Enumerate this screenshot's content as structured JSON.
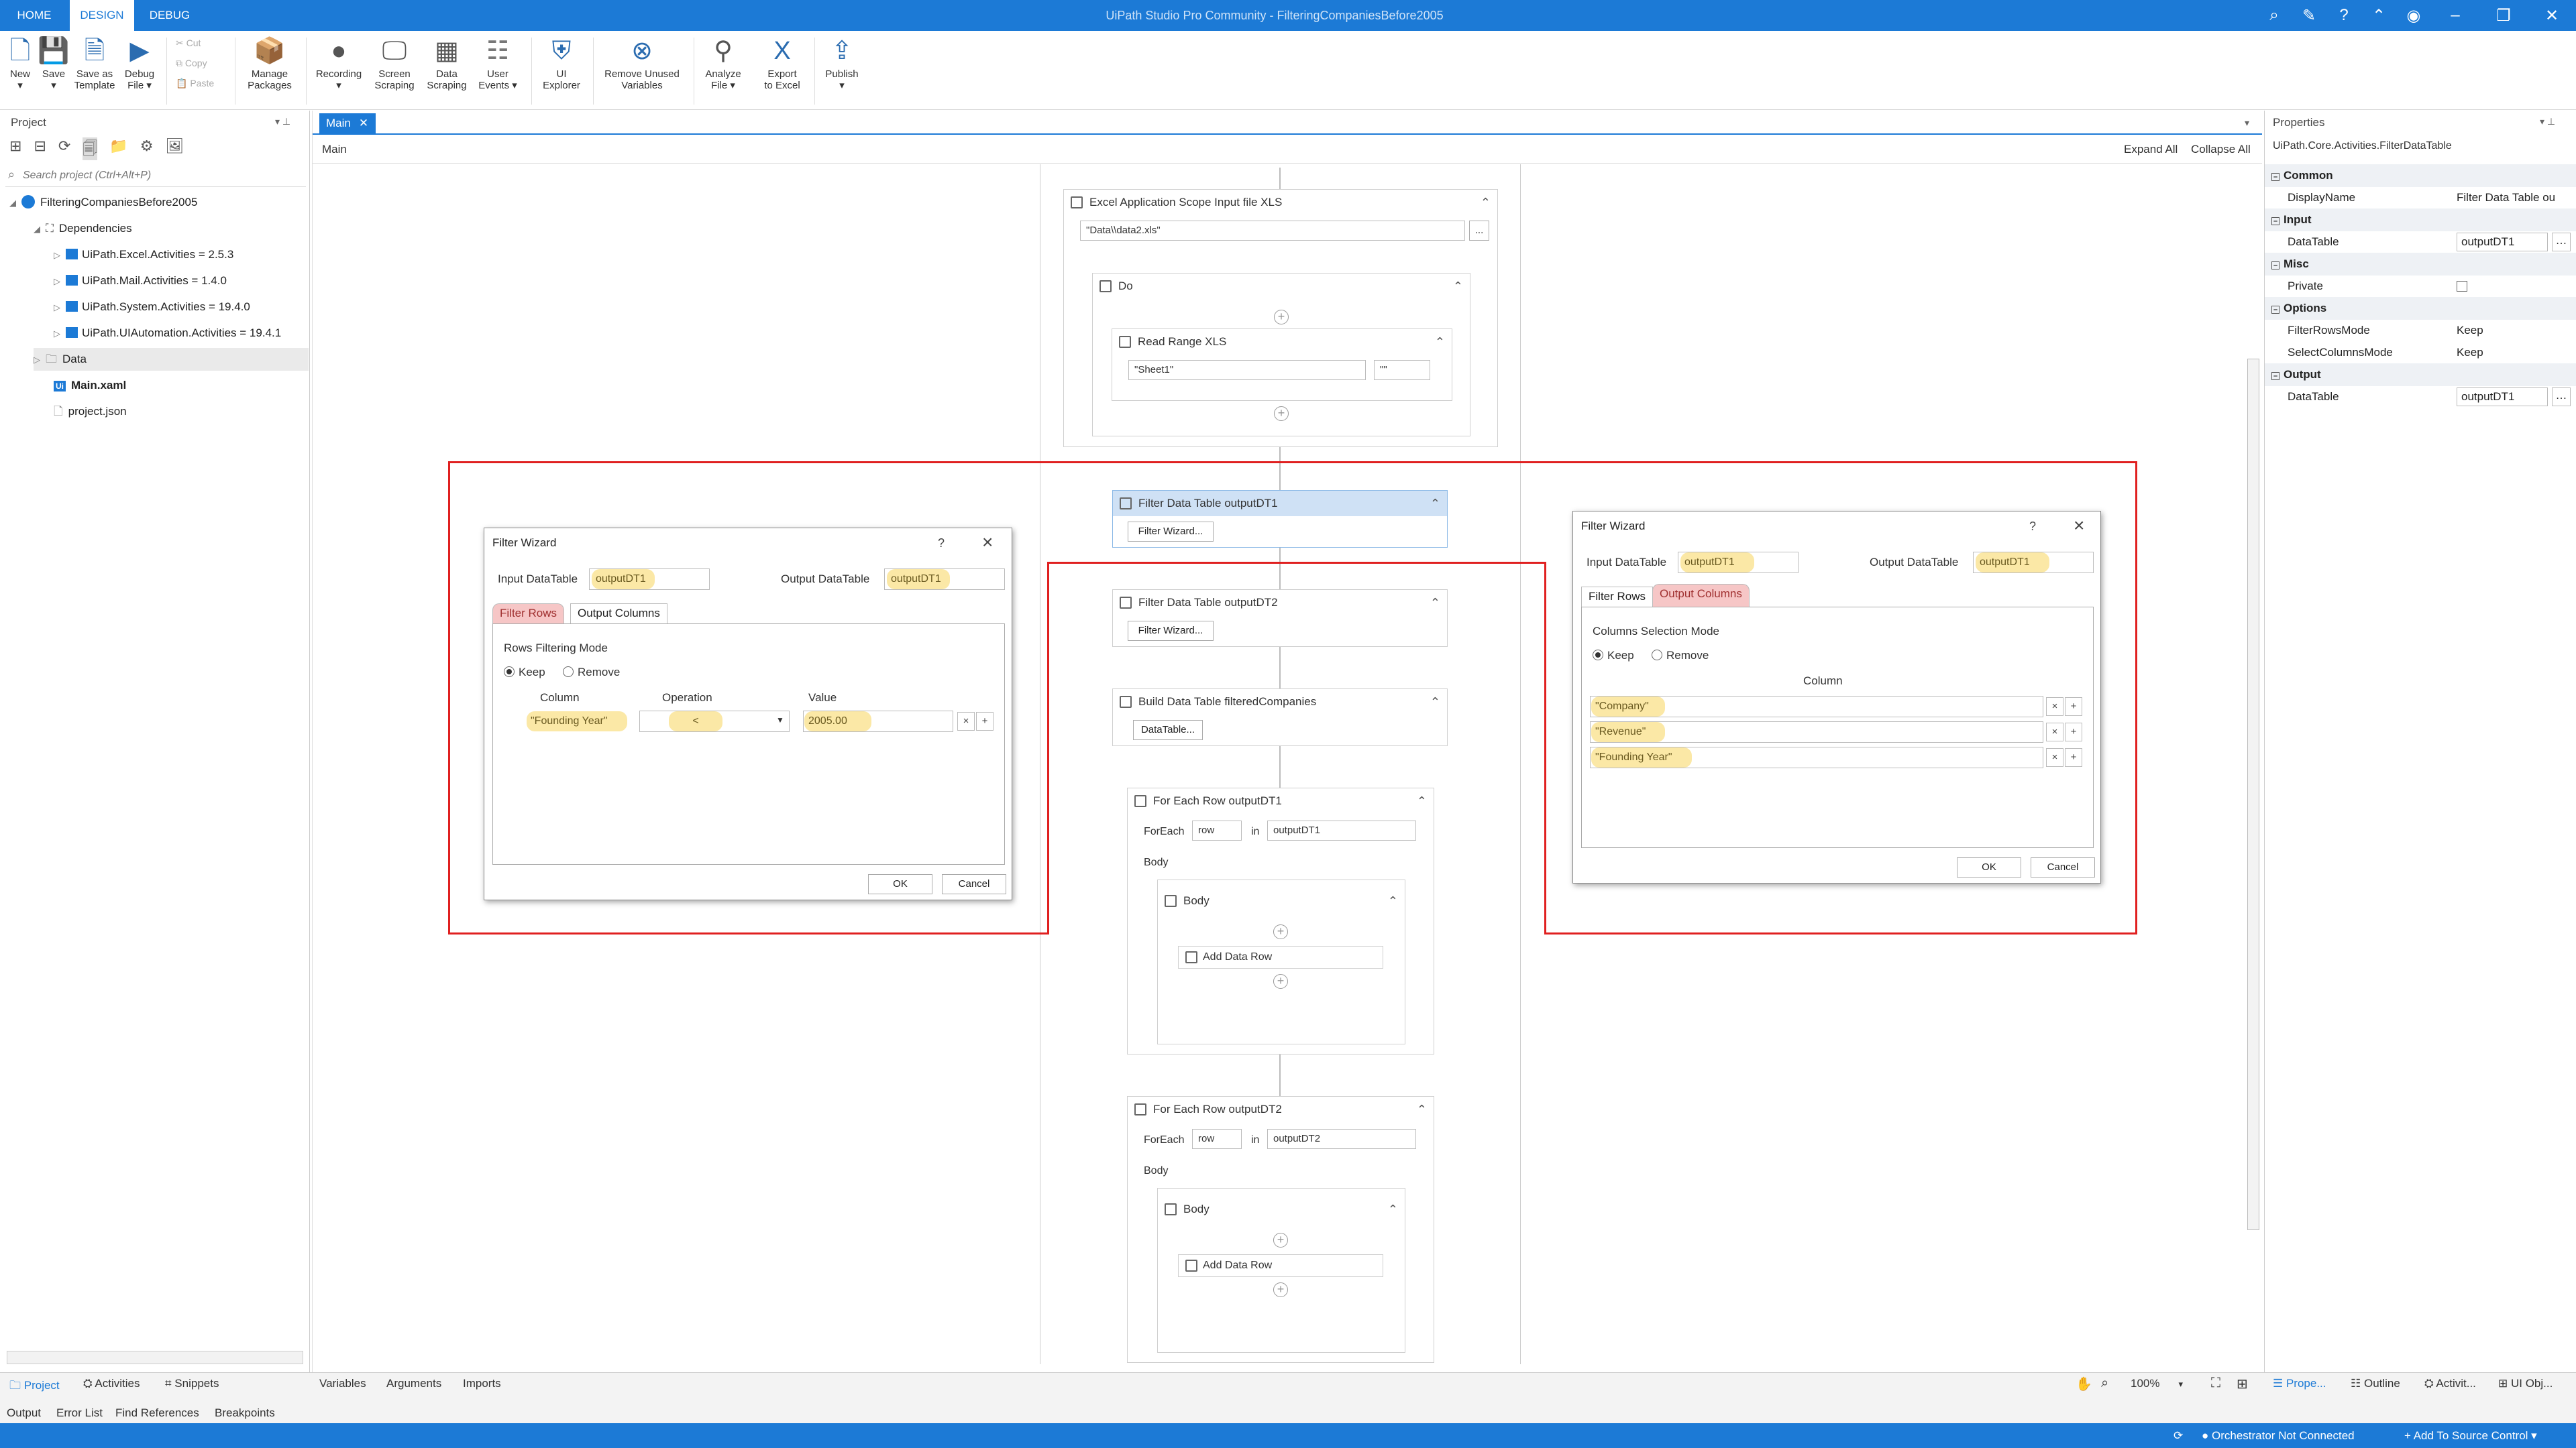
{
  "window": {
    "title": "UiPath Studio Pro Community - FilteringCompaniesBefore2005",
    "tabs": [
      "HOME",
      "DESIGN",
      "DEBUG"
    ]
  },
  "ribbon": {
    "buttons": [
      {
        "label": "New",
        "sub": "▾"
      },
      {
        "label": "Save",
        "sub": "▾"
      },
      {
        "label": "Save as",
        "sub": "Template"
      },
      {
        "label": "Debug",
        "sub": "File ▾"
      },
      {
        "label": "Manage",
        "sub": "Packages"
      },
      {
        "label": "Recording",
        "sub": "▾"
      },
      {
        "label": "Screen",
        "sub": "Scraping"
      },
      {
        "label": "Data",
        "sub": "Scraping"
      },
      {
        "label": "User",
        "sub": "Events ▾"
      },
      {
        "label": "UI",
        "sub": "Explorer"
      },
      {
        "label": "Remove Unused",
        "sub": "Variables"
      },
      {
        "label": "Analyze",
        "sub": "File ▾"
      },
      {
        "label": "Export",
        "sub": "to Excel"
      },
      {
        "label": "Publish",
        "sub": "▾"
      }
    ],
    "clipboard": [
      "Cut",
      "Copy",
      "Paste"
    ]
  },
  "project_panel": {
    "title": "Project",
    "search_placeholder": "Search project (Ctrl+Alt+P)",
    "root": "FilteringCompaniesBefore2005",
    "dependencies_label": "Dependencies",
    "dependencies": [
      "UiPath.Excel.Activities = 2.5.3",
      "UiPath.Mail.Activities = 1.4.0",
      "UiPath.System.Activities = 19.4.0",
      "UiPath.UIAutomation.Activities = 19.4.1"
    ],
    "folder": "Data",
    "main_file": "Main.xaml",
    "project_file": "project.json"
  },
  "designer": {
    "doc_tab": "Main",
    "breadcrumb": "Main",
    "expand_all": "Expand All",
    "collapse_all": "Collapse All",
    "excel_scope": {
      "title": "Excel Application Scope Input file XLS",
      "path": "\"Data\\\\data2.xls\"",
      "browse": "..."
    },
    "do_title": "Do",
    "read_range": {
      "title": "Read Range XLS",
      "sheet": "\"Sheet1\"",
      "range": "\"\""
    },
    "filter1": {
      "title": "Filter Data Table outputDT1",
      "button": "Filter Wizard..."
    },
    "filter2": {
      "title": "Filter Data Table outputDT2",
      "button": "Filter Wizard..."
    },
    "build": {
      "title": "Build Data Table filteredCompanies",
      "button": "DataTable..."
    },
    "foreach1": {
      "title": "For Each Row outputDT1",
      "foreach_label": "ForEach",
      "var": "row",
      "in_label": "in",
      "collection": "outputDT1",
      "body_label": "Body",
      "inner_body": "Body",
      "add_row": "Add Data Row"
    },
    "foreach2": {
      "title": "For Each Row outputDT2",
      "foreach_label": "ForEach",
      "var": "row",
      "in_label": "in",
      "collection": "outputDT2",
      "body_label": "Body",
      "inner_body": "Body",
      "add_row": "Add Data Row"
    }
  },
  "wizard_left": {
    "title": "Filter Wizard",
    "help": "?",
    "input_label": "Input DataTable",
    "input_value": "outputDT1",
    "output_label": "Output DataTable",
    "output_value": "outputDT1",
    "tabs": [
      "Filter Rows",
      "Output Columns"
    ],
    "mode_label": "Rows Filtering Mode",
    "keep": "Keep",
    "remove": "Remove",
    "col_headers": [
      "Column",
      "Operation",
      "Value"
    ],
    "row": {
      "column": "\"Founding Year\"",
      "operation": "<",
      "value": "2005.00"
    },
    "ok": "OK",
    "cancel": "Cancel"
  },
  "wizard_right": {
    "title": "Filter Wizard",
    "help": "?",
    "input_label": "Input DataTable",
    "input_value": "outputDT1",
    "output_label": "Output DataTable",
    "output_value": "outputDT1",
    "tabs": [
      "Filter Rows",
      "Output Columns"
    ],
    "mode_label": "Columns Selection Mode",
    "keep": "Keep",
    "remove": "Remove",
    "col_header": "Column",
    "columns": [
      "\"Company\"",
      "\"Revenue\"",
      "\"Founding Year\""
    ],
    "ok": "OK",
    "cancel": "Cancel"
  },
  "properties": {
    "title": "Properties",
    "class": "UiPath.Core.Activities.FilterDataTable",
    "rows": [
      {
        "type": "cat",
        "name": "Common"
      },
      {
        "type": "prop",
        "name": "DisplayName",
        "value": "Filter Data Table ou"
      },
      {
        "type": "cat",
        "name": "Input"
      },
      {
        "type": "prop",
        "name": "DataTable",
        "value": "outputDT1",
        "box": true
      },
      {
        "type": "cat",
        "name": "Misc"
      },
      {
        "type": "prop",
        "name": "Private",
        "value": "",
        "check": true
      },
      {
        "type": "cat",
        "name": "Options"
      },
      {
        "type": "prop",
        "name": "FilterRowsMode",
        "value": "Keep"
      },
      {
        "type": "prop",
        "name": "SelectColumnsMode",
        "value": "Keep"
      },
      {
        "type": "cat",
        "name": "Output"
      },
      {
        "type": "prop",
        "name": "DataTable",
        "value": "outputDT1",
        "box": true
      }
    ]
  },
  "bottom": {
    "left_tabs": [
      "Project",
      "Activities",
      "Snippets"
    ],
    "canvas_tabs": [
      "Variables",
      "Arguments",
      "Imports"
    ],
    "zoom": "100%",
    "right_tabs": [
      "Prope...",
      "Outline",
      "Activit...",
      "UI Obj..."
    ],
    "output_tabs": [
      "Output",
      "Error List",
      "Find References",
      "Breakpoints"
    ]
  },
  "status": {
    "orchestrator": "Orchestrator Not Connected",
    "source_control": "+ Add To Source Control ▾"
  }
}
